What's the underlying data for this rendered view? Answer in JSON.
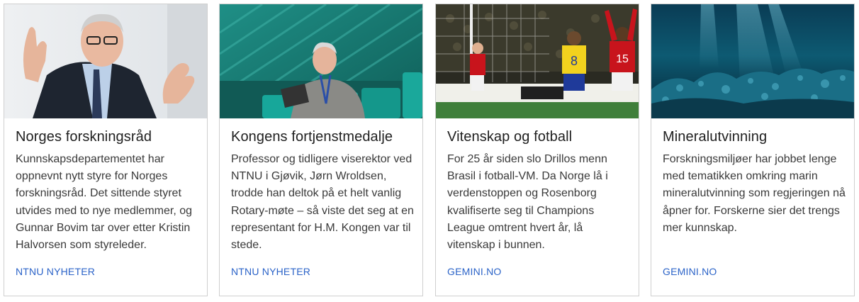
{
  "cards": [
    {
      "image": "photo-man-speaking-gesturing",
      "title": "Norges forskningsråd",
      "text": "Kunnskapsdepartementet har oppnevnt nytt styre for Norges forskningsråd. Det sittende styret utvides med to nye medlemmer, og Gunnar Bovim tar over etter Kristin Halvorsen som styreleder.",
      "source": "NTNU NYHETER"
    },
    {
      "image": "photo-man-with-laptop-in-auditorium",
      "title": "Kongens fortjenstmedalje",
      "text": "Professor og tidligere viserektor ved NTNU i Gjøvik, Jørn Wroldsen, trodde han deltok på et helt vanlig Rotary-møte – så viste det seg at en representant for H.M. Kongen var til stede.",
      "source": "NTNU NYHETER"
    },
    {
      "image": "photo-football-match-norway-brazil",
      "title": "Vitenskap og fotball",
      "text": "For 25 år siden slo Drillos menn Brasil i fotball-VM. Da Norge lå i verdenstoppen og Rosenborg kvalifiserte seg til Champions League omtrent hvert år, lå vitenskap i bunnen.",
      "source": "GEMINI.NO"
    },
    {
      "image": "photo-underwater-seabed",
      "title": "Mineralutvinning",
      "text": "Forskningsmiljøer har jobbet lenge med tematikken omkring marin mineralutvinning som regjeringen nå åpner for. Forskerne sier det trengs mer kunnskap.",
      "source": "GEMINI.NO"
    }
  ],
  "colors": {
    "title": "#1f1f1f",
    "text": "#3a3a3a",
    "source_link": "#2b63c8",
    "card_border": "#cfcfcf"
  }
}
